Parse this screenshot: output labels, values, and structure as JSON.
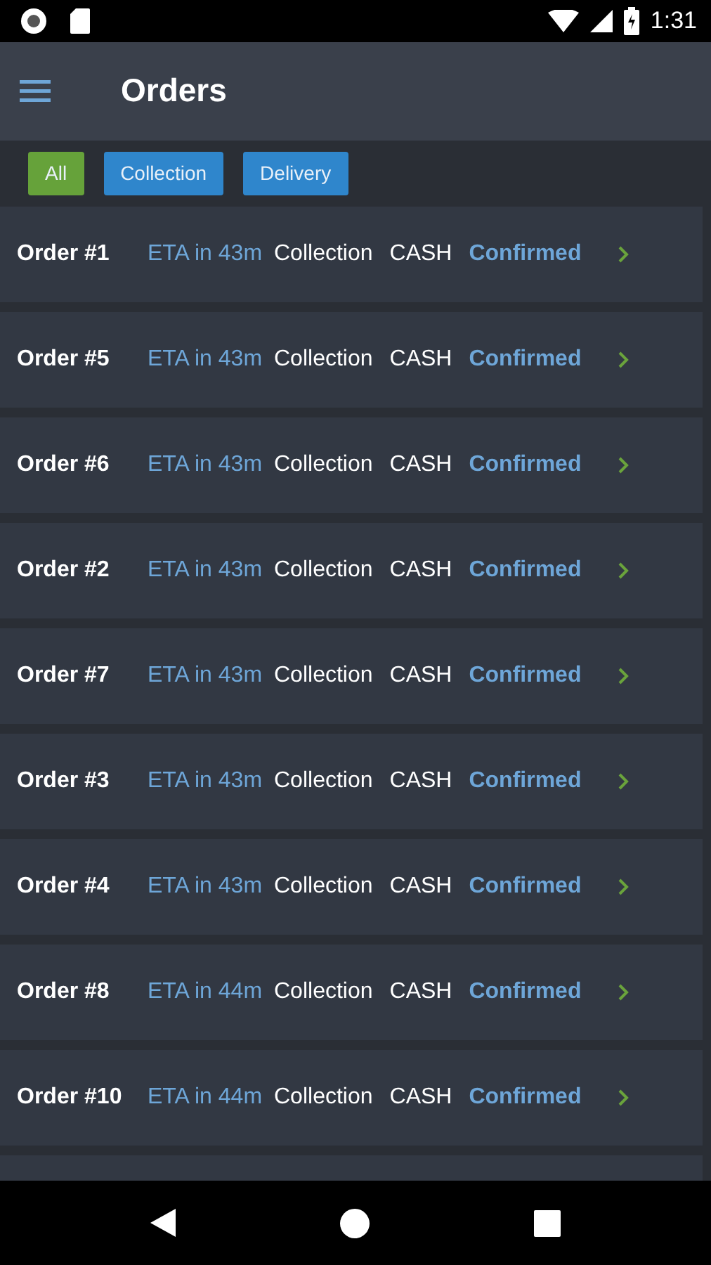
{
  "status_bar": {
    "time": "1:31"
  },
  "app_bar": {
    "title": "Orders"
  },
  "filters": [
    {
      "label": "All",
      "selected": true
    },
    {
      "label": "Collection",
      "selected": false
    },
    {
      "label": "Delivery",
      "selected": false
    }
  ],
  "orders": [
    {
      "order": "Order #1",
      "eta": "ETA in 43m",
      "type": "Collection",
      "payment": "CASH",
      "status": "Confirmed"
    },
    {
      "order": "Order #5",
      "eta": "ETA in 43m",
      "type": "Collection",
      "payment": "CASH",
      "status": "Confirmed"
    },
    {
      "order": "Order #6",
      "eta": "ETA in 43m",
      "type": "Collection",
      "payment": "CASH",
      "status": "Confirmed"
    },
    {
      "order": "Order #2",
      "eta": "ETA in 43m",
      "type": "Collection",
      "payment": "CASH",
      "status": "Confirmed"
    },
    {
      "order": "Order #7",
      "eta": "ETA in 43m",
      "type": "Collection",
      "payment": "CASH",
      "status": "Confirmed"
    },
    {
      "order": "Order #3",
      "eta": "ETA in 43m",
      "type": "Collection",
      "payment": "CASH",
      "status": "Confirmed"
    },
    {
      "order": "Order #4",
      "eta": "ETA in 43m",
      "type": "Collection",
      "payment": "CASH",
      "status": "Confirmed"
    },
    {
      "order": "Order #8",
      "eta": "ETA in 44m",
      "type": "Collection",
      "payment": "CASH",
      "status": "Confirmed"
    },
    {
      "order": "Order #10",
      "eta": "ETA in 44m",
      "type": "Collection",
      "payment": "CASH",
      "status": "Confirmed"
    }
  ]
}
